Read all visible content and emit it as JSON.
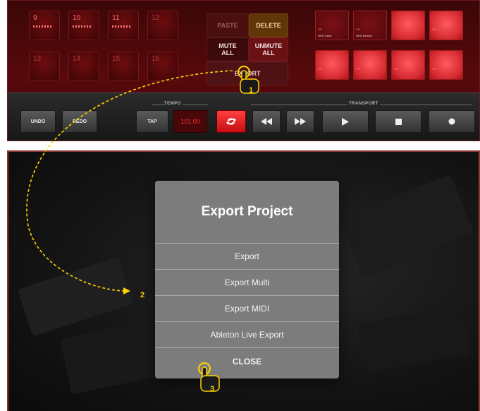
{
  "pads": [
    {
      "number": "9",
      "has_content": true
    },
    {
      "number": "10",
      "has_content": true
    },
    {
      "number": "11",
      "has_content": true
    },
    {
      "number": "12",
      "has_content": false
    },
    {
      "number": "13",
      "has_content": false
    },
    {
      "number": "14",
      "has_content": false
    },
    {
      "number": "15",
      "has_content": false
    },
    {
      "number": "16",
      "has_content": false
    }
  ],
  "edit_buttons": {
    "paste": "PASTE",
    "delete": "DELETE",
    "mute_all_line1": "MUTE",
    "mute_all_line2": "ALL",
    "unmute_all_line1": "UNMUTE",
    "unmute_all_line2": "ALL",
    "export": "EXPORT"
  },
  "sample_pads": [
    {
      "label": "NHG Latch",
      "style": "dim"
    },
    {
      "label": "NHG Electric",
      "style": "dim"
    },
    {
      "label": "",
      "style": "bright"
    },
    {
      "label": "",
      "style": "bright"
    },
    {
      "label": "",
      "style": "bright"
    },
    {
      "label": "",
      "style": "bright"
    },
    {
      "label": "",
      "style": "bright"
    },
    {
      "label": "",
      "style": "bright"
    }
  ],
  "transport_bar": {
    "undo": "UNDO",
    "redo": "REDO",
    "tempo_heading": "TEMPO",
    "tap": "TAP",
    "tempo_value": "101.00",
    "transport_heading": "TRANSPORT",
    "loop_icon": "loop-icon",
    "rewind_icon": "rewind-icon",
    "fast_forward_icon": "fast-forward-icon",
    "play_icon": "play-icon",
    "stop_icon": "stop-icon",
    "record_icon": "record-icon"
  },
  "export_dialog": {
    "title": "Export Project",
    "items": [
      "Export",
      "Export Multi",
      "Export MIDI",
      "Ableton Live Export"
    ],
    "close": "CLOSE"
  },
  "annotations": {
    "step_1": "1",
    "step_2": "2",
    "step_3": "3",
    "hand_icon": "pointing-hand-icon",
    "arrow_color": "#ffd400"
  },
  "colors": {
    "accent_red": "#e0252b",
    "dialog_bg": "#7c7c7c",
    "tempo_text": "#ff3030"
  }
}
